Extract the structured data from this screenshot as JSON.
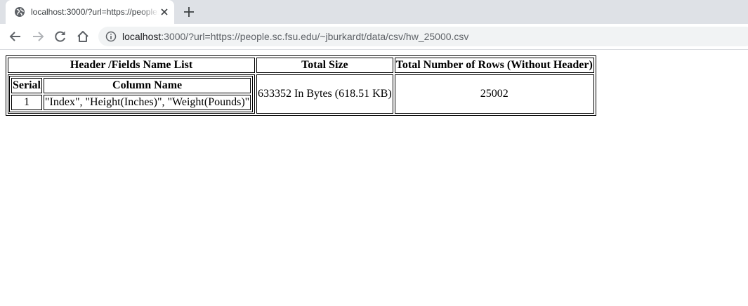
{
  "browser": {
    "tab": {
      "title": "localhost:3000/?url=https://people.sc.fsu.edu/~jburkardt/data/csv/hw_25000.csv",
      "favicon": "globe-icon"
    },
    "address_bar": {
      "host": "localhost",
      "rest": ":3000/?url=https://people.sc.fsu.edu/~jburkardt/data/csv/hw_25000.csv"
    },
    "icons": {
      "back": "back-arrow-icon",
      "forward": "forward-arrow-icon",
      "reload": "reload-icon",
      "home": "home-icon",
      "info": "info-icon",
      "close_tab": "close-icon",
      "new_tab": "plus-icon"
    }
  },
  "summary_table": {
    "headers": {
      "fields": "Header /Fields Name List",
      "size": "Total Size",
      "rows": "Total Number of Rows (Without Header)"
    },
    "fields_table": {
      "headers": {
        "serial": "Serial",
        "column_name": "Column Name"
      },
      "rows": [
        {
          "serial": "1",
          "column_name": "\"Index\", \"Height(Inches)\", \"Weight(Pounds)\""
        }
      ]
    },
    "total_size": "633352 In Bytes (618.51 KB)",
    "total_rows": "25002"
  }
}
